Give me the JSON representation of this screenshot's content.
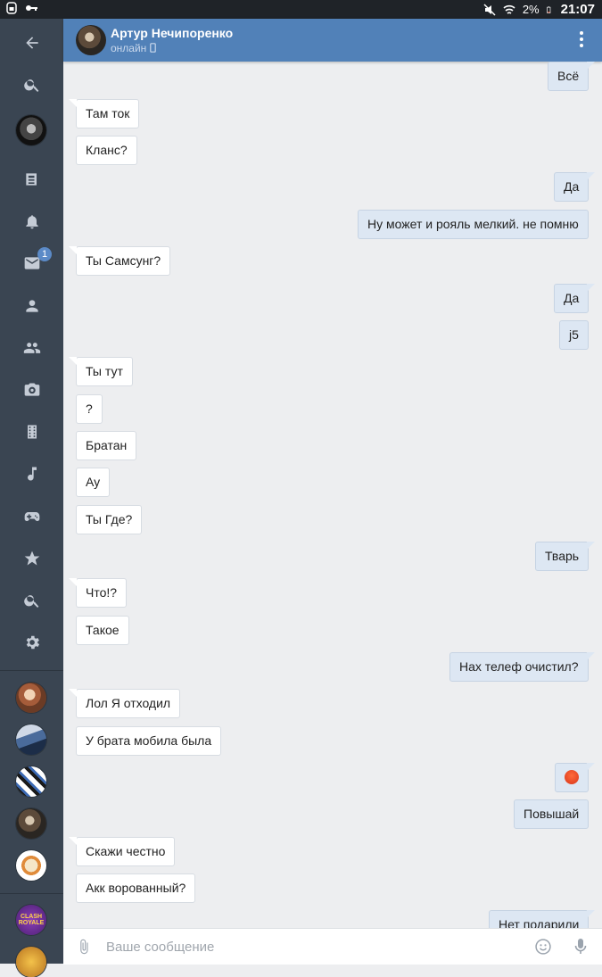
{
  "status_bar": {
    "battery": "2%",
    "time": "21:07"
  },
  "header": {
    "name": "Артур Нечипоренко",
    "status": "онлайн"
  },
  "rail": {
    "messages_badge": "1",
    "clash_label": "CLASH ROYALE"
  },
  "messages": [
    {
      "dir": "out",
      "text": "Всё"
    },
    {
      "dir": "in",
      "text": "Там ток"
    },
    {
      "dir": "in",
      "text": "Кланс?"
    },
    {
      "dir": "out",
      "text": "Да"
    },
    {
      "dir": "out",
      "text": "Ну может и рояль мелкий. не помню"
    },
    {
      "dir": "in",
      "text": "Ты Самсунг?"
    },
    {
      "dir": "out",
      "text": "Да"
    },
    {
      "dir": "out",
      "text": "j5"
    },
    {
      "dir": "in",
      "text": "Ты тут"
    },
    {
      "dir": "in",
      "text": "?"
    },
    {
      "dir": "in",
      "text": "Братан"
    },
    {
      "dir": "in",
      "text": "Ау"
    },
    {
      "dir": "in",
      "text": "Ты Где?"
    },
    {
      "dir": "out",
      "text": "Тварь"
    },
    {
      "dir": "in",
      "text": "Что!?"
    },
    {
      "dir": "in",
      "text": "Такое"
    },
    {
      "dir": "out",
      "text": "Нах телеф очистил?"
    },
    {
      "dir": "in",
      "text": "Лол Я отходил"
    },
    {
      "dir": "in",
      "text": "У брата мобила была"
    },
    {
      "dir": "out",
      "text": "",
      "emoji": "angry-face"
    },
    {
      "dir": "out",
      "text": "Повышай"
    },
    {
      "dir": "in",
      "text": "Скажи честно"
    },
    {
      "dir": "in",
      "text": "Акк ворованный?"
    },
    {
      "dir": "out",
      "text": "Нет подарили"
    }
  ],
  "input": {
    "placeholder": "Ваше сообщение"
  },
  "colors": {
    "header": "#5181b8",
    "rail": "#3a4552",
    "outgoing_bubble": "#dde7f3",
    "background": "#edeef0"
  }
}
